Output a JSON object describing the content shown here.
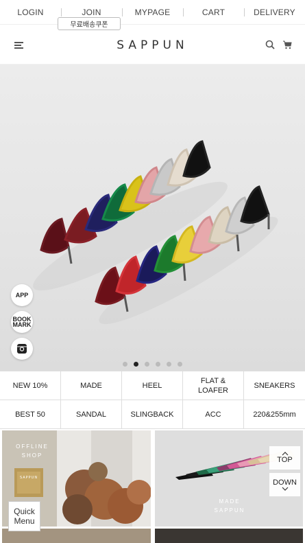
{
  "topnav": {
    "items": [
      "LOGIN",
      "JOIN",
      "MYPAGE",
      "CART",
      "DELIVERY"
    ],
    "coupon_badge": "무료배송쿠폰"
  },
  "header": {
    "logo": "SAPPUN"
  },
  "hero": {
    "side_buttons": [
      "APP",
      "BOOK\nMARK",
      ""
    ],
    "slides_count": 6,
    "active_slide": 2
  },
  "categories": [
    [
      "NEW 10%",
      "MADE",
      "HEEL",
      "FLAT &\nLOAFER",
      "SNEAKERS"
    ],
    [
      "BEST 50",
      "SANDAL",
      "SLINGBACK",
      "ACC",
      "220&255mm"
    ]
  ],
  "promos": {
    "left_text": "OFFLINE\nSHOP",
    "right_text": "MADE\nSAPPUN"
  },
  "floating": {
    "quick_menu": "Quick\nMenu",
    "top": "TOP",
    "down": "DOWN"
  },
  "colors": {
    "accent": "#222222",
    "heel_colors": [
      "#7a1c22",
      "#1f1f5e",
      "#0f6b3a",
      "#d9c21a",
      "#e3a5a8",
      "#c9c9c9",
      "#111111"
    ]
  }
}
